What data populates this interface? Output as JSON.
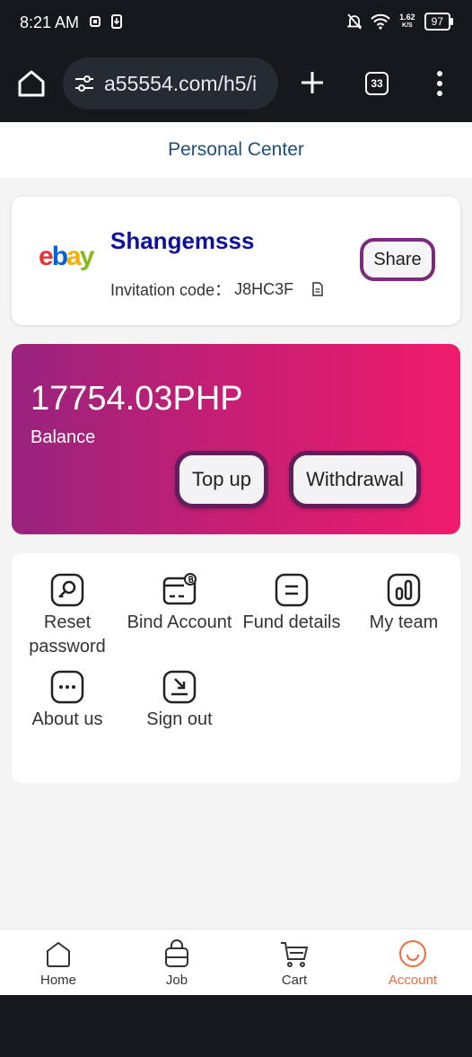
{
  "status_bar": {
    "time": "8:21 AM",
    "net_speed_value": "1.62",
    "net_speed_unit": "K/S",
    "battery": "97"
  },
  "browser": {
    "url": "a55554.com/h5/i",
    "tab_count": "33"
  },
  "header": {
    "title": "Personal Center"
  },
  "profile": {
    "logo_letters": [
      "e",
      "b",
      "a",
      "y"
    ],
    "username": "Shangemsss",
    "invite_label": "Invitation code：",
    "invite_code": "J8HC3F",
    "share_label": "Share"
  },
  "balance": {
    "amount": "17754.03PHP",
    "label": "Balance",
    "top_up_label": "Top up",
    "withdrawal_label": "Withdrawal"
  },
  "menu": {
    "items": [
      {
        "label": "Reset password",
        "icon": "key-icon"
      },
      {
        "label": "Bind Account",
        "icon": "card-icon"
      },
      {
        "label": "Fund details",
        "icon": "list-icon"
      },
      {
        "label": "My team",
        "icon": "bar-chart-icon"
      },
      {
        "label": "About us",
        "icon": "dots-icon"
      },
      {
        "label": "Sign out",
        "icon": "sign-out-icon"
      }
    ]
  },
  "tabs": [
    {
      "label": "Home",
      "icon": "home-icon"
    },
    {
      "label": "Job",
      "icon": "bag-icon"
    },
    {
      "label": "Cart",
      "icon": "cart-icon"
    },
    {
      "label": "Account",
      "icon": "smile-icon",
      "active": true
    }
  ],
  "colors": {
    "accent": "#f06a3c",
    "title_blue": "#1d4f7a",
    "username_blue": "#10109e",
    "button_border": "#7b2a7c",
    "gradient_start": "#98237e",
    "gradient_end": "#f01b6b"
  }
}
